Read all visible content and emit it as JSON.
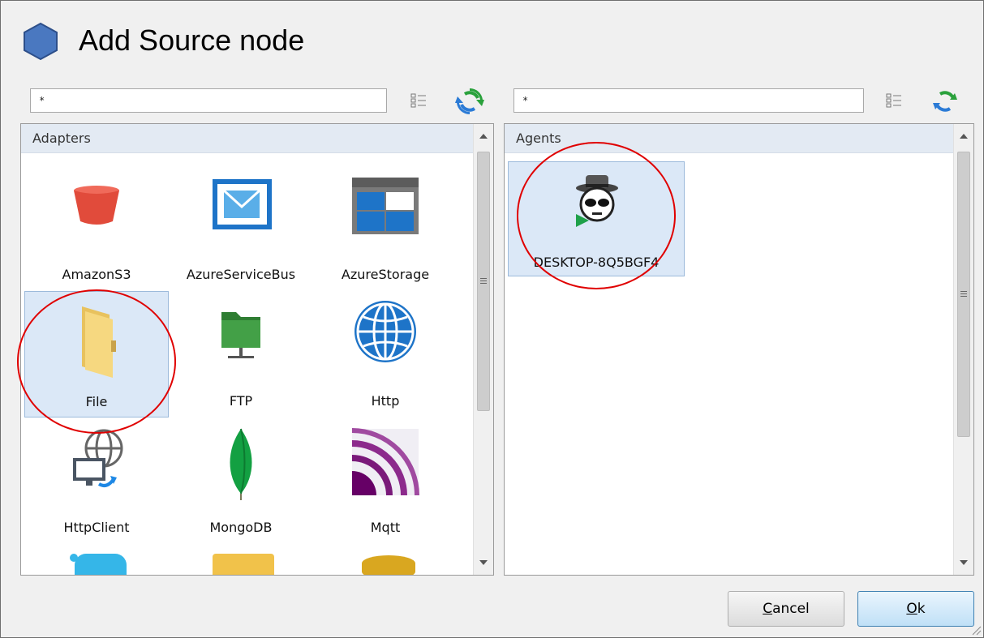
{
  "dialog": {
    "title": "Add Source node"
  },
  "left": {
    "search_value": "*",
    "header": "Adapters",
    "items": [
      {
        "label": "AmazonS3",
        "icon": "bucket-icon"
      },
      {
        "label": "AzureServiceBus",
        "icon": "envelope-icon"
      },
      {
        "label": "AzureStorage",
        "icon": "storage-grid-icon"
      },
      {
        "label": "File",
        "icon": "folder-icon",
        "selected": true
      },
      {
        "label": "FTP",
        "icon": "network-folder-icon"
      },
      {
        "label": "Http",
        "icon": "globe-icon"
      },
      {
        "label": "HttpClient",
        "icon": "globe-computer-icon"
      },
      {
        "label": "MongoDB",
        "icon": "leaf-icon"
      },
      {
        "label": "Mqtt",
        "icon": "mqtt-icon"
      }
    ]
  },
  "right": {
    "search_value": "*",
    "header": "Agents",
    "items": [
      {
        "label": "DESKTOP-8Q5BGF4",
        "icon": "agent-spy-icon",
        "selected": true
      }
    ]
  },
  "buttons": {
    "cancel_label_hotkey": "C",
    "cancel_label_rest": "ancel",
    "ok_label_hotkey": "O",
    "ok_label_rest": "k"
  },
  "colors": {
    "annotation": "#e00000",
    "selection": "#dbe8f7"
  }
}
